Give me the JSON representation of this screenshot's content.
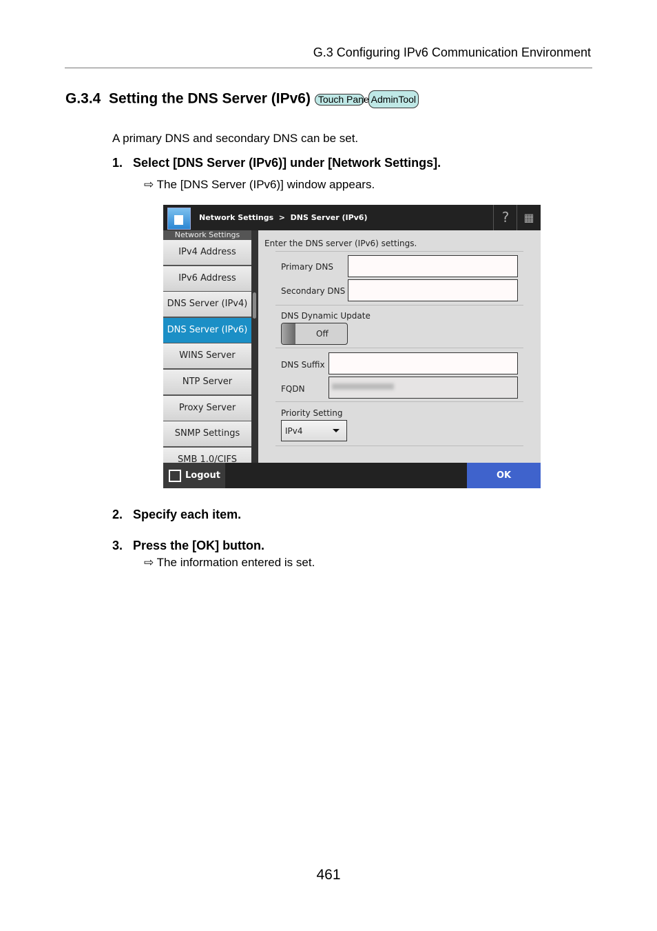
{
  "header": {
    "section": "G.3 Configuring IPv6 Communication Environment"
  },
  "heading": {
    "number": "G.3.4",
    "title": "Setting the DNS Server (IPv6)",
    "badges": [
      "Touch Panel",
      "AdminTool"
    ]
  },
  "intro": "A primary DNS and secondary DNS can be set.",
  "steps": [
    {
      "num": "1.",
      "text": "Select [DNS Server (IPv6)] under [Network Settings].",
      "result": "The [DNS Server (IPv6)] window appears."
    },
    {
      "num": "2.",
      "text": "Specify each item."
    },
    {
      "num": "3.",
      "text": "Press the [OK] button.",
      "result": "The information entered is set."
    }
  ],
  "screen": {
    "breadcrumb": "Network Settings  >  DNS Server (IPv6)",
    "sidebar_header": "Network Settings",
    "sidebar_items": [
      "IPv4 Address",
      "IPv6 Address",
      "DNS Server (IPv4)",
      "DNS Server (IPv6)",
      "WINS Server",
      "NTP Server",
      "Proxy Server",
      "SNMP Settings",
      "SMB 1.0/CIFS"
    ],
    "selected_item": "DNS Server (IPv6)",
    "instruction": "Enter the DNS server (IPv6) settings.",
    "primary_dns_label": "Primary DNS",
    "primary_dns_value": "",
    "secondary_dns_label": "Secondary DNS",
    "secondary_dns_value": "",
    "dynamic_update_label": "DNS Dynamic Update",
    "dynamic_update_value": "Off",
    "dns_suffix_label": "DNS Suffix",
    "dns_suffix_value": "",
    "fqdn_label": "FQDN",
    "priority_label": "Priority Setting",
    "priority_value": "IPv4",
    "logout": "Logout",
    "ok": "OK",
    "accent": "#1b8fc6",
    "ok_color": "#3f63cc"
  },
  "page_number": "461"
}
